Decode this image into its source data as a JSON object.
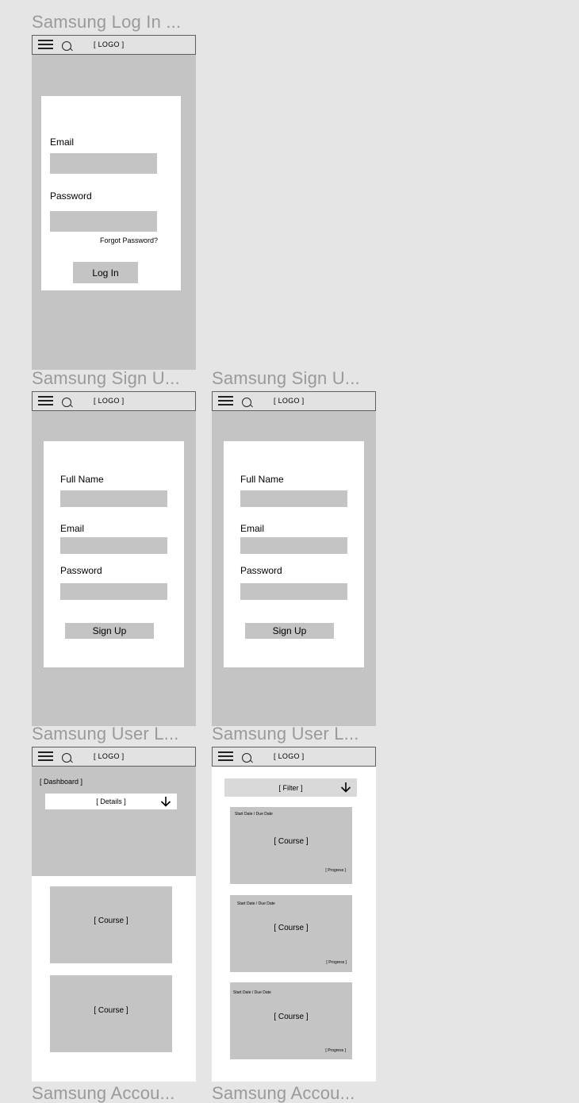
{
  "nav": {
    "logo": "[ LOGO ]"
  },
  "frames": {
    "login": {
      "title": "Samsung Log In ...",
      "email_label": "Email",
      "password_label": "Password",
      "forgot": "Forgot Password?",
      "login_button": "Log In"
    },
    "signup_1": {
      "title": "Samsung Sign U...",
      "fullname_label": "Full Name",
      "email_label": "Email",
      "password_label": "Password",
      "signup_button": "Sign Up"
    },
    "signup_2": {
      "title": "Samsung Sign U...",
      "fullname_label": "Full Name",
      "email_label": "Email",
      "password_label": "Password",
      "signup_button": "Sign Up"
    },
    "user_1": {
      "title": "Samsung User L...",
      "dashboard": "[ Dashboard ]",
      "details": "[ Details ]",
      "courses": [
        "[ Course ]",
        "[ Course ]"
      ]
    },
    "user_2": {
      "title": "Samsung User L...",
      "filter": "[ Filter ]",
      "courses": [
        {
          "dates": "Start Date / Due Date",
          "name": "[ Course ]",
          "progress": "[ Progress ]"
        },
        {
          "dates": "Start Date / Due Date",
          "name": "[ Course ]",
          "progress": "[ Progress ]"
        },
        {
          "dates": "Start Date / Due Date",
          "name": "[ Course ]",
          "progress": "[ Progress ]"
        }
      ]
    },
    "account_1": {
      "title": "Samsung Accou..."
    },
    "account_2": {
      "title": "Samsung Accou..."
    }
  }
}
